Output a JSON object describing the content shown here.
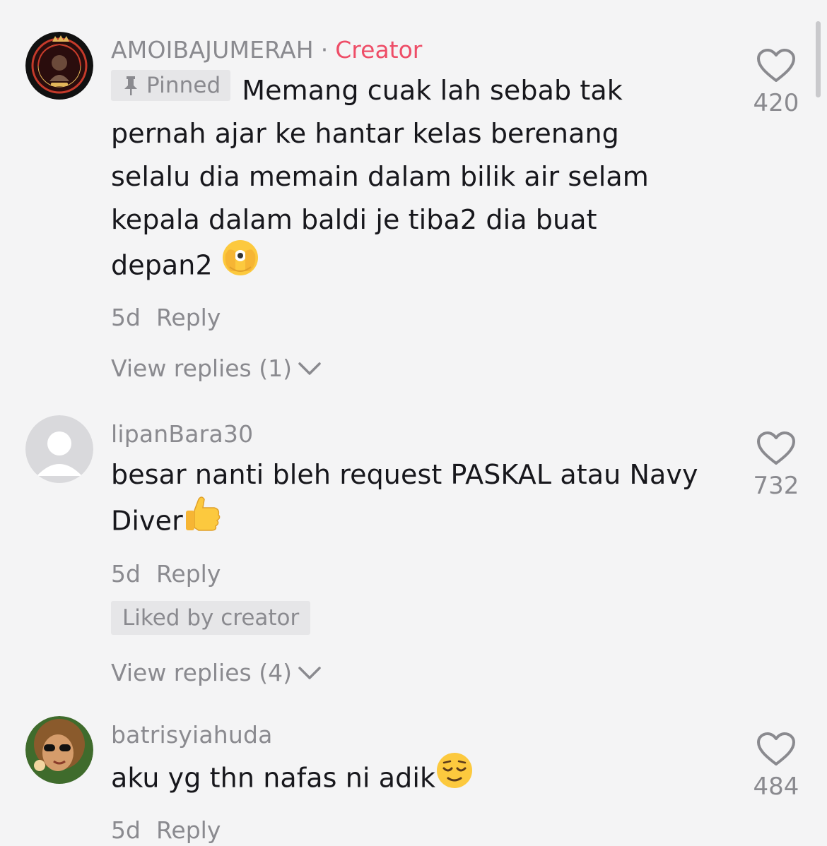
{
  "comments": [
    {
      "username": "AMOIBAJUMERAH",
      "separator": "·",
      "badge": "Creator",
      "pinned_label": "Pinned",
      "text": "Memang cuak lah sebab tak pernah ajar ke hantar kelas berenang selalu dia memain dalam bilik air selam kepala dalam baldi je tiba2 dia buat depan2",
      "emoji": "face-with-open-eyes-and-hand-over-mouth",
      "age": "5d",
      "reply_label": "Reply",
      "view_replies": "View replies (1)",
      "likes": "420"
    },
    {
      "username": "lipanBara30",
      "text": "besar nanti bleh request PASKAL atau Navy Diver",
      "emoji": "thumbs-up",
      "age": "5d",
      "reply_label": "Reply",
      "liked_by": "Liked by creator",
      "view_replies": "View replies (4)",
      "likes": "732"
    },
    {
      "username": "batrisyiahuda",
      "text": "aku yg thn nafas ni adik",
      "emoji": "relieved-face",
      "age": "5d",
      "reply_label": "Reply",
      "likes": "484"
    }
  ],
  "colors": {
    "background": "#f4f4f5",
    "creator_badge": "#ee4d67",
    "muted_text": "#8a8a8f",
    "body_text": "#17171c"
  }
}
